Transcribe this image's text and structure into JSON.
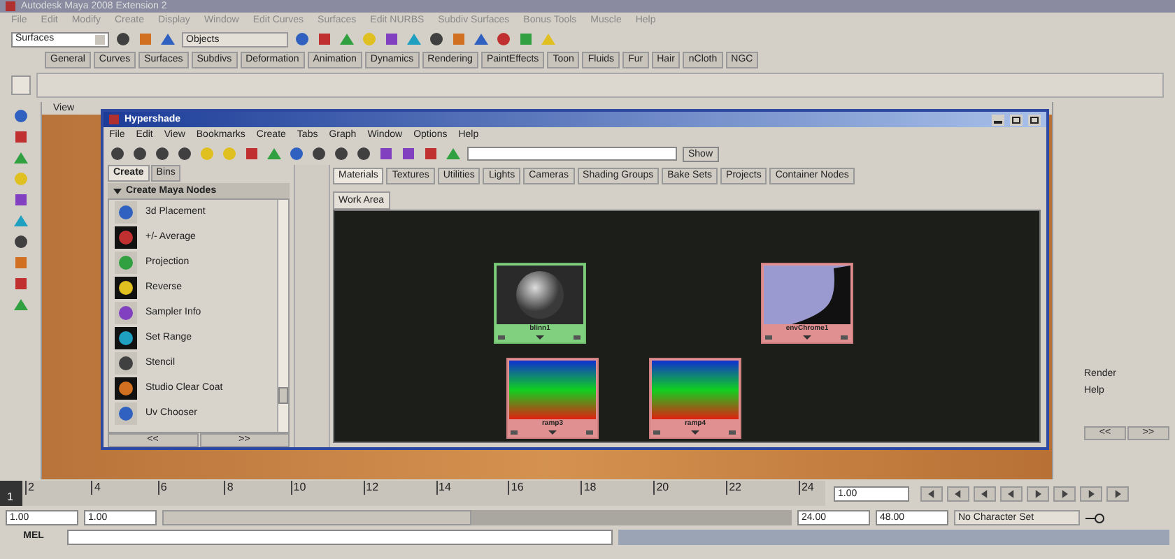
{
  "window": {
    "title": "Autodesk Maya 2008 Extension 2"
  },
  "menu": [
    "File",
    "Edit",
    "Modify",
    "Create",
    "Display",
    "Window",
    "Edit Curves",
    "Surfaces",
    "Edit NURBS",
    "Subdiv Surfaces",
    "Bonus Tools",
    "Muscle",
    "Help"
  ],
  "status_line": {
    "mode": "Surfaces",
    "selection_field": "Objects"
  },
  "shelf_tabs": [
    "General",
    "Curves",
    "Surfaces",
    "Subdivs",
    "Deformation",
    "Animation",
    "Dynamics",
    "Rendering",
    "PaintEffects",
    "Toon",
    "Fluids",
    "Fur",
    "Hair",
    "nCloth",
    "NGC"
  ],
  "viewport": {
    "menu": [
      "View"
    ]
  },
  "hypershade": {
    "title": "Hypershade",
    "menu": [
      "File",
      "Edit",
      "View",
      "Bookmarks",
      "Create",
      "Tabs",
      "Graph",
      "Window",
      "Options",
      "Help"
    ],
    "show_button": "Show",
    "create_tabs": [
      {
        "label": "Create",
        "selected": true
      },
      {
        "label": "Bins",
        "selected": false
      }
    ],
    "section": "Create Maya Nodes",
    "nodes": [
      "3d Placement",
      "+/- Average",
      "Projection",
      "Reverse",
      "Sampler Info",
      "Set Range",
      "Stencil",
      "Studio Clear Coat",
      "Uv Chooser"
    ],
    "nav": [
      "<<",
      ">>"
    ],
    "tabs": [
      {
        "label": "Materials",
        "selected": true
      },
      {
        "label": "Textures",
        "selected": false
      },
      {
        "label": "Utilities",
        "selected": false
      },
      {
        "label": "Lights",
        "selected": false
      },
      {
        "label": "Cameras",
        "selected": false
      },
      {
        "label": "Shading Groups",
        "selected": false
      },
      {
        "label": "Bake Sets",
        "selected": false
      },
      {
        "label": "Projects",
        "selected": false
      },
      {
        "label": "Container Nodes",
        "selected": false
      }
    ],
    "work_area_tab": "Work Area",
    "swatches": [
      {
        "name": "blinn1",
        "kind": "material"
      },
      {
        "name": "envChrome1",
        "kind": "environment"
      },
      {
        "name": "ramp3",
        "kind": "ramp"
      },
      {
        "name": "ramp4",
        "kind": "ramp"
      }
    ]
  },
  "right_panel": {
    "items": [
      "Render",
      "Help"
    ],
    "nav": [
      "<<",
      ">>"
    ]
  },
  "timeline": {
    "current": "1",
    "level": 0,
    "ticks": [
      "2",
      "4",
      "6",
      "8",
      "10",
      "12",
      "14",
      "16",
      "18",
      "20",
      "22",
      "24"
    ],
    "current_field": "1.00"
  },
  "range": {
    "start": "1.00",
    "playback_start": "1.00",
    "playback_end": "24.00",
    "end": "48.00",
    "level": 0.49,
    "character_set": "No Character Set"
  },
  "command_line": {
    "label": "MEL"
  }
}
